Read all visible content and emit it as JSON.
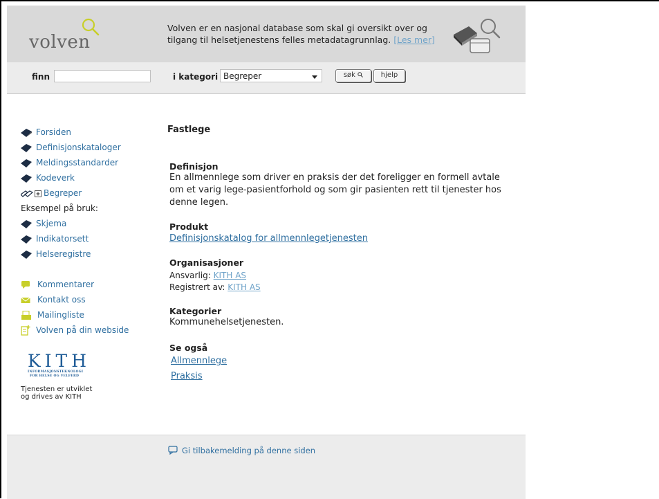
{
  "header": {
    "logo_text": "volven",
    "description": "Volven er en nasjonal database som skal gi oversikt over og tilgang til helsetjenestens felles metadatagrunnlag.",
    "read_more": "[Les mer]"
  },
  "search": {
    "finn_label": "finn",
    "finn_value": "",
    "category_label": "i kategori",
    "category_selected": "Begreper",
    "search_button": "søk",
    "help_button": "hjelp"
  },
  "sidebar": {
    "items": [
      {
        "label": "Forsiden",
        "icon": "book-icon"
      },
      {
        "label": "Definisjonskataloger",
        "icon": "book-icon"
      },
      {
        "label": "Meldingsstandarder",
        "icon": "book-icon"
      },
      {
        "label": "Kodeverk",
        "icon": "book-icon"
      },
      {
        "label": "Begreper",
        "icon": "open-book-icon"
      }
    ],
    "usage_heading": "Eksempel på bruk:",
    "usage_items": [
      {
        "label": "Skjema",
        "icon": "book-icon"
      },
      {
        "label": "Indikatorsett",
        "icon": "book-icon"
      },
      {
        "label": "Helseregistre",
        "icon": "book-icon"
      }
    ],
    "extra_items": [
      {
        "label": "Kommentarer",
        "icon": "comment-icon"
      },
      {
        "label": "Kontakt oss",
        "icon": "mail-icon"
      },
      {
        "label": "Mailingliste",
        "icon": "mailing-list-icon"
      },
      {
        "label": "Volven på din webside",
        "icon": "document-add-icon"
      }
    ],
    "kith_logo": "KITH",
    "kith_sub1": "INFORMASJONSTEKNOLOGI",
    "kith_sub2": "FOR HELSE OG VELFERD",
    "kith_note_line1": "Tjenesten er utviklet",
    "kith_note_line2": "og drives av KITH"
  },
  "content": {
    "title": "Fastlege",
    "definition_heading": "Definisjon",
    "definition_text": "En allmennlege som driver en praksis der det foreligger en formell avtale om et varig lege-pasientforhold og som gir pasienten rett til tjenester hos denne legen.",
    "product_heading": "Produkt",
    "product_link": "Definisjonskatalog for allmennlegetjenesten",
    "org_heading": "Organisasjoner",
    "responsible_label": "Ansvarlig:",
    "responsible_link": "KITH AS",
    "registered_label": "Registrert av:",
    "registered_link": "KITH AS",
    "categories_heading": "Kategorier",
    "categories_text": "Kommunehelsetjenesten.",
    "see_also_heading": "Se også",
    "see_also_links": [
      "Allmennlege",
      "Praksis"
    ]
  },
  "footer": {
    "feedback": "Gi tilbakemelding på denne siden"
  },
  "colors": {
    "header_bg": "#d9d9d9",
    "link": "#2f6fa0",
    "light_link": "#6fa3c9",
    "kith_blue": "#1f5c97",
    "lens_yellow": "#c8cf2a"
  }
}
